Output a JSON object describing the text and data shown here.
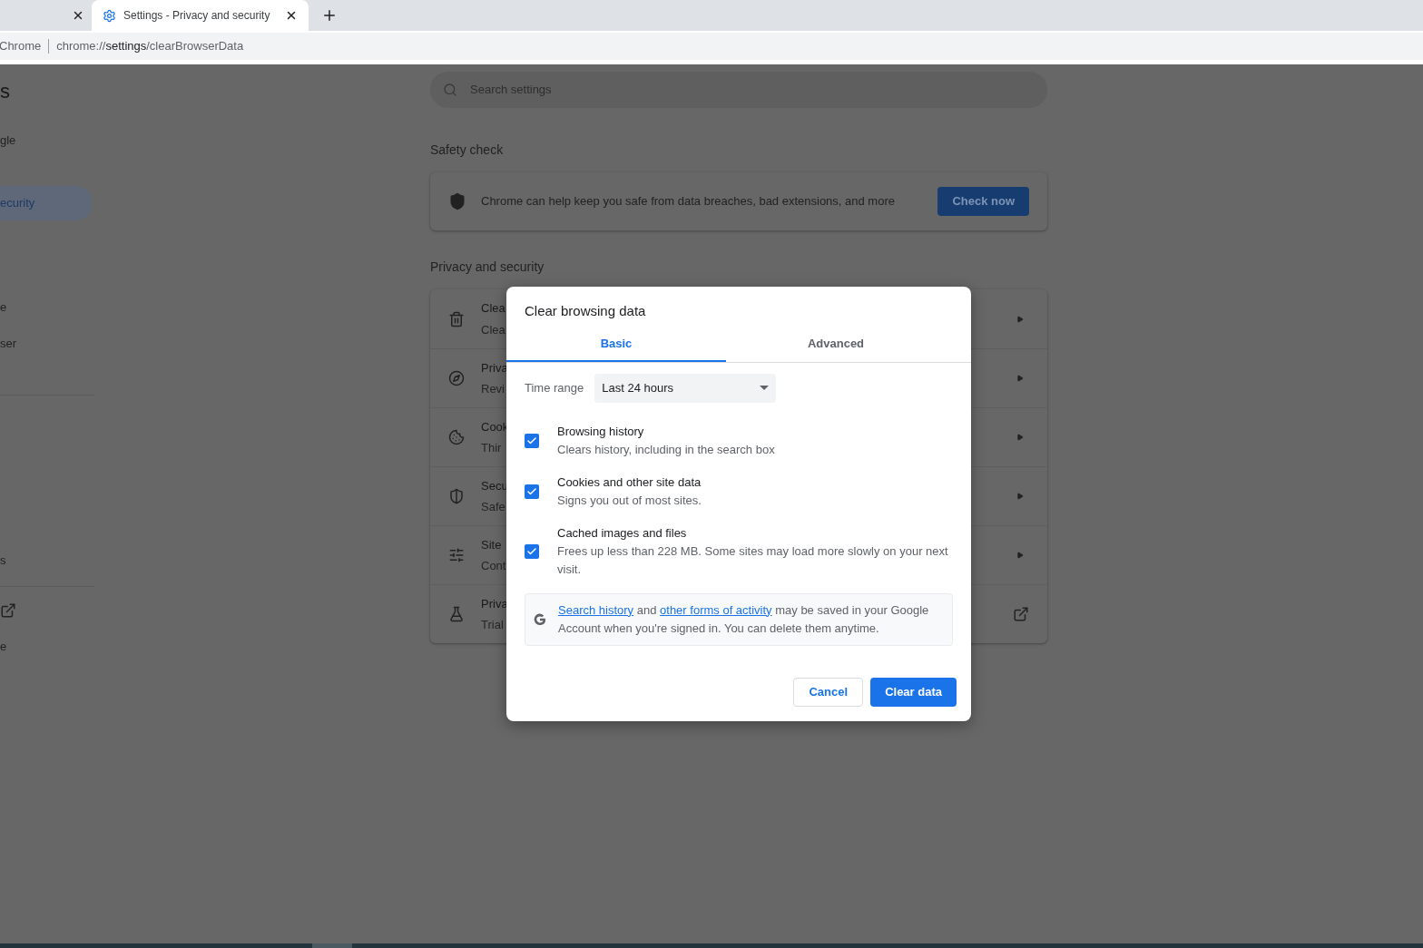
{
  "browser": {
    "tabs": [
      {
        "selected": false
      },
      {
        "title": "Settings - Privacy and security",
        "selected": true
      }
    ],
    "address": {
      "site_label": "Chrome",
      "url_scheme": "chrome://",
      "url_host": "settings",
      "url_path": "/clearBrowserData"
    }
  },
  "sidebar": {
    "heading": "s",
    "groups": [
      [
        {
          "label": "gle",
          "selected": false
        },
        {
          "label": "ecurity",
          "selected": true
        },
        {
          "label": "e",
          "selected": false
        },
        {
          "label": "ser",
          "selected": false
        }
      ],
      [
        {
          "label": "s",
          "selected": false
        }
      ],
      [
        {
          "kind": "external",
          "selected": false
        },
        {
          "label": "e",
          "selected": false
        }
      ]
    ]
  },
  "search": {
    "placeholder": "Search settings"
  },
  "safety_check": {
    "heading": "Safety check",
    "text": "Chrome can help keep you safe from data breaches, bad extensions, and more",
    "button": "Check now"
  },
  "privacy": {
    "heading": "Privacy and security",
    "rows": [
      {
        "title": "Clea",
        "subtitle": "Clea",
        "kind": "submenu"
      },
      {
        "title": "Priva",
        "subtitle": "Revi",
        "kind": "submenu"
      },
      {
        "title": "Cook",
        "subtitle": "Thir",
        "kind": "submenu"
      },
      {
        "title": "Secu",
        "subtitle": "Safe",
        "kind": "submenu"
      },
      {
        "title": "Site",
        "subtitle": "Cont",
        "kind": "submenu"
      },
      {
        "title": "Priva",
        "subtitle": "Trial",
        "kind": "external"
      }
    ]
  },
  "dialog": {
    "title": "Clear browsing data",
    "tabs": [
      {
        "label": "Basic",
        "selected": true
      },
      {
        "label": "Advanced",
        "selected": false
      }
    ],
    "time_range": {
      "label": "Time range",
      "value": "Last 24 hours"
    },
    "options": [
      {
        "title": "Browsing history",
        "description": "Clears history, including in the search box",
        "checked": true
      },
      {
        "title": "Cookies and other site data",
        "description": "Signs you out of most sites.",
        "checked": true
      },
      {
        "title": "Cached images and files",
        "description": "Frees up less than 228 MB. Some sites may load more slowly on your next visit.",
        "checked": true
      }
    ],
    "notice": {
      "link_1": "Search history",
      "text_1": "and",
      "link_2": "other forms of activity",
      "text_2": "may be saved in your Google Account when you're signed in. You can delete them anytime."
    },
    "buttons": {
      "cancel": "Cancel",
      "confirm": "Clear data"
    }
  }
}
